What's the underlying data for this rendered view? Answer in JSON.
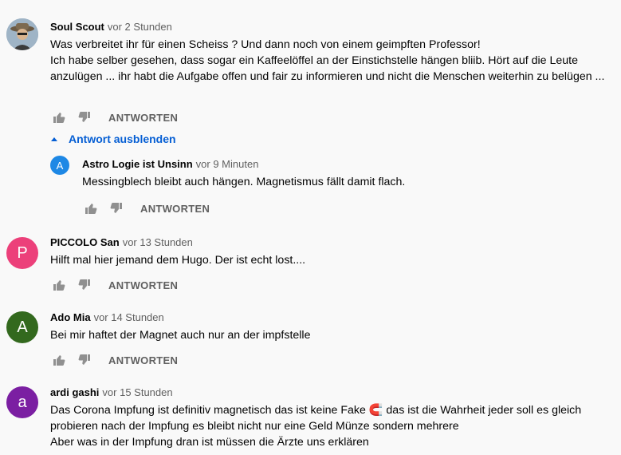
{
  "comments": [
    {
      "author": "Soul Scout",
      "time": "vor 2 Stunden",
      "text": "Was verbreitet ihr für einen Scheiss ? Und dann noch von einem geimpften Professor!\nIch habe selber gesehen, dass sogar ein Kaffeelöffel an der Einstichstelle hängen bliib. Hört auf die Leute anzulügen ... ihr habt die Aufgabe offen und fair zu informieren und nicht die Menschen weiterhin zu belügen ...",
      "reply_label": "ANTWORTEN",
      "avatar_type": "photo"
    },
    {
      "author": "Astro Logie ist Unsinn",
      "time": "vor 9 Minuten",
      "text": "Messingblech bleibt auch hängen. Magnetismus fällt damit flach.",
      "reply_label": "ANTWORTEN",
      "avatar_letter": "A",
      "avatar_color": "#1e88e5"
    },
    {
      "author": "PICCOLO San",
      "time": "vor 13 Stunden",
      "text": "Hilft mal hier jemand dem Hugo. Der ist echt lost....",
      "reply_label": "ANTWORTEN",
      "avatar_letter": "P",
      "avatar_color": "#ec407a"
    },
    {
      "author": "Ado Mia",
      "time": "vor 14 Stunden",
      "text": "Bei mir haftet der Magnet auch nur an der impfstelle",
      "reply_label": "ANTWORTEN",
      "avatar_letter": "A",
      "avatar_color": "#33691e"
    },
    {
      "author": "ardi gashi",
      "time": "vor 15 Stunden",
      "text": "Das Corona Impfung ist definitiv magnetisch das ist keine Fake 🧲 das ist die Wahrheit jeder soll es gleich probieren nach der Impfung es bleibt nicht nur eine Geld Münze sondern mehrere\nAber was in der Impfung dran ist müssen die Ärzte uns erklären",
      "avatar_letter": "a",
      "avatar_color": "#7b1fa2"
    }
  ],
  "hide_replies_label": "Antwort ausblenden",
  "colors": {
    "link": "#065fd4",
    "secondary": "#606060",
    "background": "#f9f9f9"
  }
}
